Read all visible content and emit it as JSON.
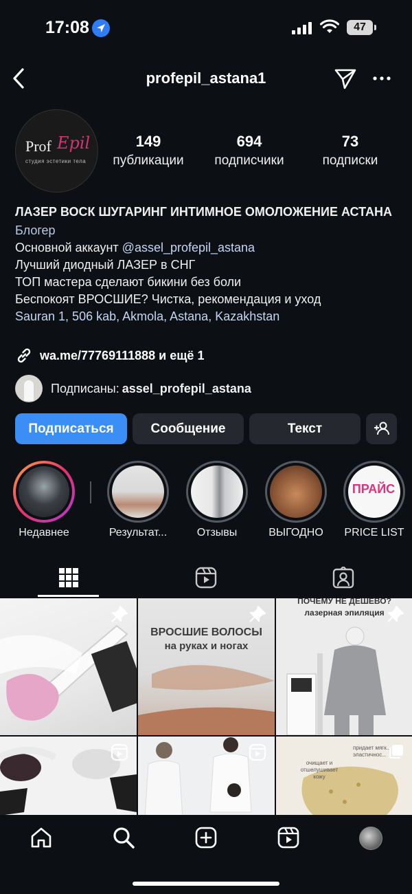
{
  "status_bar": {
    "time": "17:08",
    "battery": "47"
  },
  "nav": {
    "username": "profepil_astana1"
  },
  "avatar": {
    "brand_line1": "Prof",
    "brand_line2": "Epil",
    "brand_sub": "студия эстетики тела"
  },
  "stats": [
    {
      "value": "149",
      "label": "публикации"
    },
    {
      "value": "694",
      "label": "подписчики"
    },
    {
      "value": "73",
      "label": "подписки"
    }
  ],
  "bio": {
    "name": "ЛАЗЕР ВОСК ШУГАРИНГ ИНТИМНОЕ ОМОЛОЖЕНИЕ АСТАНА",
    "category": "Блогер",
    "line1_prefix": "Основной аккаунт ",
    "line1_mention": "@assel_profepil_astana",
    "line2": "Лучший диодный ЛАЗЕР в СНГ",
    "line3": "ТОП мастера сделают бикини без боли",
    "line4": "Беспокоят ВРОСШИЕ? Чистка, рекомендация и уход",
    "address": "Sauran 1, 506 kab, Akmola, Astana, Kazakhstan",
    "link": "wa.me/77769111888 и ещё 1"
  },
  "followed_by": {
    "prefix": "Подписаны:",
    "user": "assel_profepil_astana"
  },
  "buttons": {
    "follow": "Подписаться",
    "message": "Сообщение",
    "text": "Текст"
  },
  "highlights": [
    {
      "label": "Недавнее"
    },
    {
      "label": "Результат..."
    },
    {
      "label": "Отзывы"
    },
    {
      "label": "ВЫГОДНО"
    },
    {
      "label": "PRICE LIST",
      "cover_text": "ПРАЙС"
    }
  ],
  "posts": {
    "post2_title": "ВРОСШИЕ ВОЛОСЫ",
    "post2_subtitle": "на руках и ногах",
    "post3_title": "ПОЧЕМУ НЕ ДЕШЕВО?",
    "post3_subtitle": "лазерная эпиляция",
    "post6_note1": "придает мягк... и эластичнос...",
    "post6_note2": "очищает и отшелушивает кожу"
  },
  "colors": {
    "accent": "#3a8ef6",
    "background": "#0c0f14",
    "button": "#25292f",
    "link": "#c6d6f3"
  }
}
